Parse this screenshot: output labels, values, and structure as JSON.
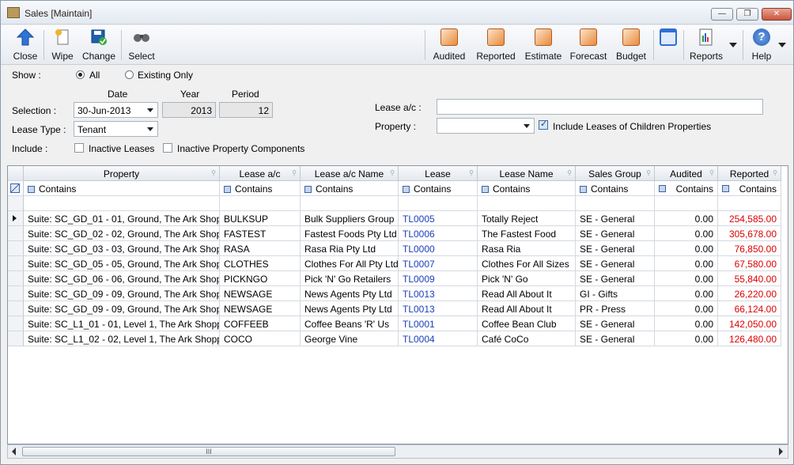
{
  "window": {
    "title": "Sales [Maintain]",
    "min": "—",
    "max": "❐",
    "close": "✕"
  },
  "toolbar": {
    "left": [
      {
        "id": "close",
        "label": "Close",
        "color": "#2f6fd3"
      },
      {
        "id": "wipe",
        "label": "Wipe",
        "color": "#e7a23a"
      },
      {
        "id": "change",
        "label": "Change",
        "color": "#1f6fb5"
      },
      {
        "id": "select",
        "label": "Select",
        "color": "#555"
      }
    ],
    "right": [
      {
        "id": "audited",
        "label": "Audited"
      },
      {
        "id": "reported",
        "label": "Reported"
      },
      {
        "id": "estimate",
        "label": "Estimate"
      },
      {
        "id": "forecast",
        "label": "Forecast"
      },
      {
        "id": "budget",
        "label": "Budget"
      },
      {
        "id": "reports",
        "label": "Reports"
      },
      {
        "id": "help",
        "label": "Help"
      }
    ]
  },
  "filters": {
    "show_label": "Show :",
    "all": "All",
    "existing_only": "Existing Only",
    "date_header": "Date",
    "year_header": "Year",
    "period_header": "Period",
    "selection_label": "Selection :",
    "selection_date": "30-Jun-2013",
    "year": "2013",
    "period": "12",
    "lease_type_label": "Lease Type :",
    "lease_type": "Tenant",
    "include_label": "Include :",
    "inactive_leases": "Inactive Leases",
    "inactive_components": "Inactive Property Components",
    "lease_ac_label": "Lease a/c :",
    "lease_ac_value": "",
    "property_label": "Property :",
    "property_value": "",
    "include_children": "Include Leases of Children Properties"
  },
  "grid": {
    "columns": [
      "Property",
      "Lease a/c",
      "Lease a/c Name",
      "Lease",
      "Lease Name",
      "Sales Group",
      "Audited",
      "Reported"
    ],
    "filter_text": "Contains",
    "rows": [
      [
        "Suite: SC_GD_01 - 01, Ground, The Ark Shopp",
        "BULKSUP",
        "Bulk Suppliers Group",
        "TL0005",
        "Totally Reject",
        "SE - General",
        "0.00",
        "254,585.00"
      ],
      [
        "Suite: SC_GD_02 - 02, Ground, The Ark Shopp",
        "FASTEST",
        "Fastest Foods Pty Ltd",
        "TL0006",
        "The Fastest Food",
        "SE - General",
        "0.00",
        "305,678.00"
      ],
      [
        "Suite: SC_GD_03 - 03, Ground, The Ark Shopp",
        "RASA",
        "Rasa Ria Pty Ltd",
        "TL0000",
        "Rasa Ria",
        "SE - General",
        "0.00",
        "76,850.00"
      ],
      [
        "Suite: SC_GD_05 - 05, Ground, The Ark Shopp",
        "CLOTHES",
        "Clothes For All Pty Ltd",
        "TL0007",
        "Clothes For All Sizes",
        "SE - General",
        "0.00",
        "67,580.00"
      ],
      [
        "Suite: SC_GD_06 - 06, Ground, The Ark Shopp",
        "PICKNGO",
        "Pick 'N' Go Retailers",
        "TL0009",
        "Pick 'N' Go",
        "SE - General",
        "0.00",
        "55,840.00"
      ],
      [
        "Suite: SC_GD_09 - 09, Ground, The Ark Shopp",
        "NEWSAGE",
        "News Agents Pty Ltd",
        "TL0013",
        "Read All About It",
        "GI - Gifts",
        "0.00",
        "26,220.00"
      ],
      [
        "Suite: SC_GD_09 - 09, Ground, The Ark Shopp",
        "NEWSAGE",
        "News Agents Pty Ltd",
        "TL0013",
        "Read All About It",
        "PR - Press",
        "0.00",
        "66,124.00"
      ],
      [
        "Suite: SC_L1_01 - 01, Level 1, The Ark Shoppi",
        "COFFEEB",
        "Coffee Beans 'R' Us",
        "TL0001",
        "Coffee Bean Club",
        "SE - General",
        "0.00",
        "142,050.00"
      ],
      [
        "Suite: SC_L1_02 - 02, Level 1, The Ark Shoppi",
        "COCO",
        "George Vine",
        "TL0004",
        "Café CoCo",
        "SE - General",
        "0.00",
        "126,480.00"
      ]
    ]
  },
  "scroll": {
    "thumb": "III"
  }
}
